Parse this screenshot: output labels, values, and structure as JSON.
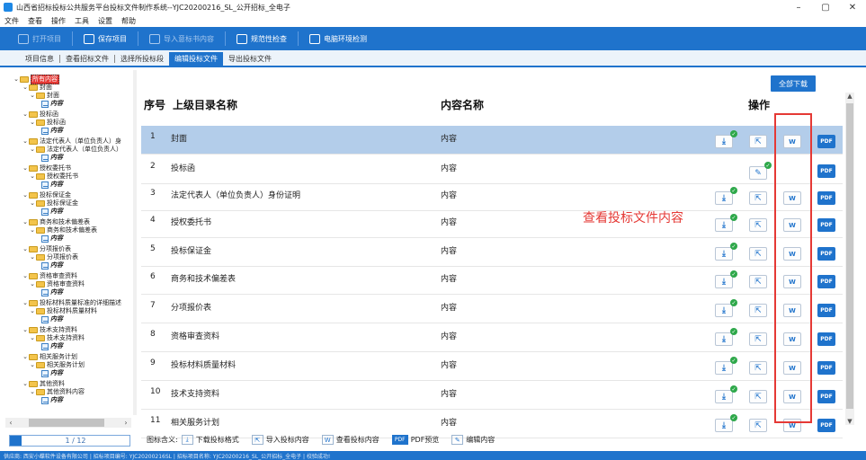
{
  "window": {
    "title": "山西省招标投标公共服务平台投标文件制作系统--YJC20200216_SL_公开招标_全电子",
    "minimize": "–",
    "maximize": "▢",
    "close": "✕"
  },
  "menu": [
    "文件",
    "查看",
    "操作",
    "工具",
    "设置",
    "帮助"
  ],
  "toolbar": [
    {
      "label": "打开项目",
      "enabled": false,
      "icon": "open-project-icon"
    },
    {
      "label": "保存项目",
      "enabled": true,
      "icon": "save-project-icon"
    },
    {
      "label": "导入意标书内容",
      "enabled": false,
      "icon": "import-tender-icon"
    },
    {
      "label": "规范性检查",
      "enabled": true,
      "icon": "standard-check-icon"
    },
    {
      "label": "电脑环境检测",
      "enabled": true,
      "icon": "env-check-icon"
    }
  ],
  "tabs": [
    {
      "label": "项目信息",
      "active": false
    },
    {
      "label": "查看招标文件",
      "active": false
    },
    {
      "label": "选择所投标段",
      "active": false
    },
    {
      "label": "编辑投标文件",
      "active": true
    },
    {
      "label": "导出投标文件",
      "active": false
    }
  ],
  "tree": {
    "root": "所有内容",
    "content_label": "内容",
    "nodes": [
      {
        "title": "封面",
        "child": "封面"
      },
      {
        "title": "投标函",
        "child": "投标函"
      },
      {
        "title": "法定代表人（单位负责人）身",
        "child": "法定代表人（单位负责人）"
      },
      {
        "title": "授权委托书",
        "child": "授权委托书"
      },
      {
        "title": "投标保证金",
        "child": "投标保证金"
      },
      {
        "title": "商务和技术偏差表",
        "child": "商务和技术偏差表"
      },
      {
        "title": "分项报价表",
        "child": "分项报价表"
      },
      {
        "title": "资格审查资料",
        "child": "资格审查资料"
      },
      {
        "title": "投标材料质量标准的详细描述",
        "child": "投标材料质量材料"
      },
      {
        "title": "技术支持资料",
        "child": "技术支持资料"
      },
      {
        "title": "相关服务计划",
        "child": "相关服务计划"
      },
      {
        "title": "其他资料",
        "child": "其他资料内容"
      }
    ],
    "pager": "1 / 12"
  },
  "main": {
    "download_all": "全部下载",
    "headers": {
      "num": "序号",
      "parent": "上级目录名称",
      "content": "内容名称",
      "ops": "操作"
    },
    "rows": [
      {
        "num": "1",
        "name": "封面",
        "content": "内容",
        "selected": true,
        "download": true,
        "import": true,
        "word": true,
        "edit": false
      },
      {
        "num": "2",
        "name": "投标函",
        "content": "内容",
        "selected": false,
        "download": false,
        "import": false,
        "word": false,
        "edit": true
      },
      {
        "num": "3",
        "name": "法定代表人（单位负责人）身份证明",
        "content": "内容",
        "selected": false,
        "download": true,
        "import": true,
        "word": true,
        "edit": false
      },
      {
        "num": "4",
        "name": "授权委托书",
        "content": "内容",
        "selected": false,
        "download": true,
        "import": true,
        "word": true,
        "edit": false
      },
      {
        "num": "5",
        "name": "投标保证金",
        "content": "内容",
        "selected": false,
        "download": true,
        "import": true,
        "word": true,
        "edit": false
      },
      {
        "num": "6",
        "name": "商务和技术偏差表",
        "content": "内容",
        "selected": false,
        "download": true,
        "import": true,
        "word": true,
        "edit": false
      },
      {
        "num": "7",
        "name": "分项报价表",
        "content": "内容",
        "selected": false,
        "download": true,
        "import": true,
        "word": true,
        "edit": false
      },
      {
        "num": "8",
        "name": "资格审查资料",
        "content": "内容",
        "selected": false,
        "download": true,
        "import": true,
        "word": true,
        "edit": false
      },
      {
        "num": "9",
        "name": "投标材料质量材料",
        "content": "内容",
        "selected": false,
        "download": true,
        "import": true,
        "word": true,
        "edit": false
      },
      {
        "num": "10",
        "name": "技术支持资料",
        "content": "内容",
        "selected": false,
        "download": true,
        "import": true,
        "word": true,
        "edit": false
      },
      {
        "num": "11",
        "name": "相关服务计划",
        "content": "内容",
        "selected": false,
        "download": true,
        "import": true,
        "word": true,
        "edit": false
      }
    ],
    "pdf_label": "PDF",
    "word_label": "W",
    "annotation": "查看投标文件内容"
  },
  "legend": {
    "title": "图标含义:",
    "items": [
      {
        "icon": "download-icon",
        "label": "下载投标格式"
      },
      {
        "icon": "import-icon",
        "label": "导入投标内容"
      },
      {
        "icon": "word-icon",
        "label": "查看投标内容"
      },
      {
        "icon": "pdf-icon",
        "label": "PDF预览"
      },
      {
        "icon": "edit-icon",
        "label": "编辑内容"
      }
    ]
  },
  "statusbar": "供应商: 西安小蝶软件设备有限公司 | 招标项目编号: YJC20200216SL | 招标项目名称: YJC20200216_SL_公开招标_全电子 | 校验成功!",
  "colors": {
    "accent": "#1f73cc",
    "highlight": "#e53935",
    "selected_row": "#b3cdea",
    "success": "#2ea84a"
  }
}
